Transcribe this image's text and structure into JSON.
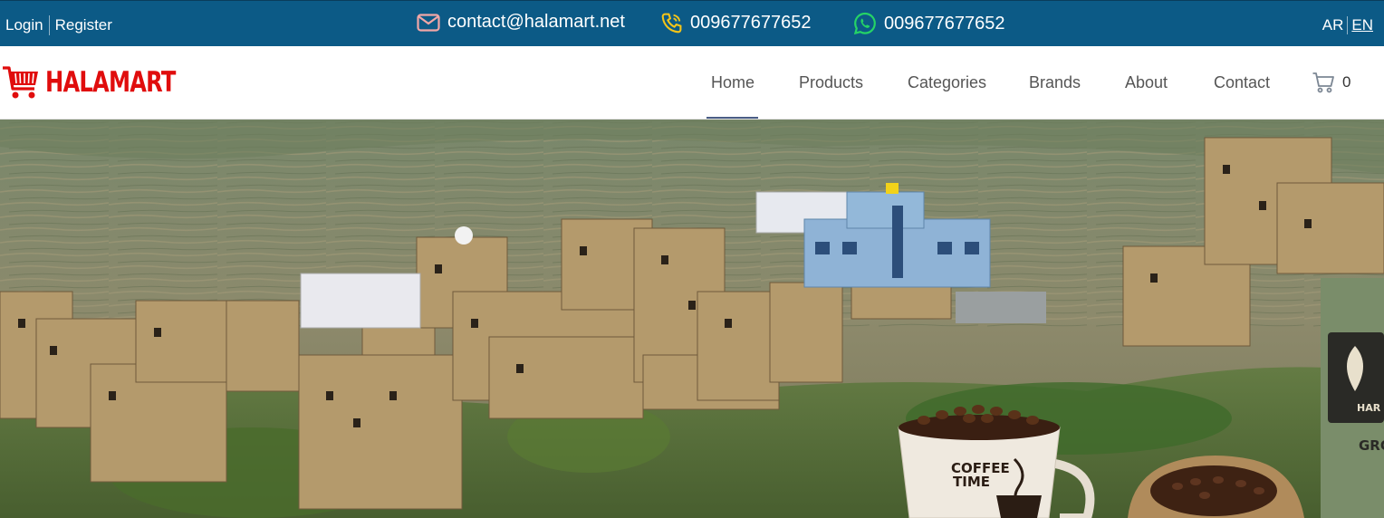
{
  "topbar": {
    "login": "Login",
    "register": "Register",
    "email": "contact@halamart.net",
    "phone": "009677677652",
    "whatsapp": "009677677652",
    "lang_ar": "AR",
    "lang_en": "EN",
    "colors": {
      "background": "#0c5a86",
      "mail_icon": "#f2a7a7",
      "phone_icon": "#f5c518",
      "whatsapp_icon": "#25d366"
    }
  },
  "nav": {
    "logo_text": "HALAMART",
    "logo_icon": "shopping-cart-icon",
    "items": [
      "Home",
      "Products",
      "Categories",
      "Brands",
      "About",
      "Contact"
    ],
    "active": "Home",
    "cart_count": "0",
    "colors": {
      "brand_red": "#e00d0d",
      "underline": "#4a5d86"
    }
  },
  "hero": {
    "image": "mountain-village-coffee-banner",
    "cup_text_line1": "COFFEE",
    "cup_text_line2": "TIME",
    "package_text1": "HAR",
    "package_text2": "GRO"
  }
}
